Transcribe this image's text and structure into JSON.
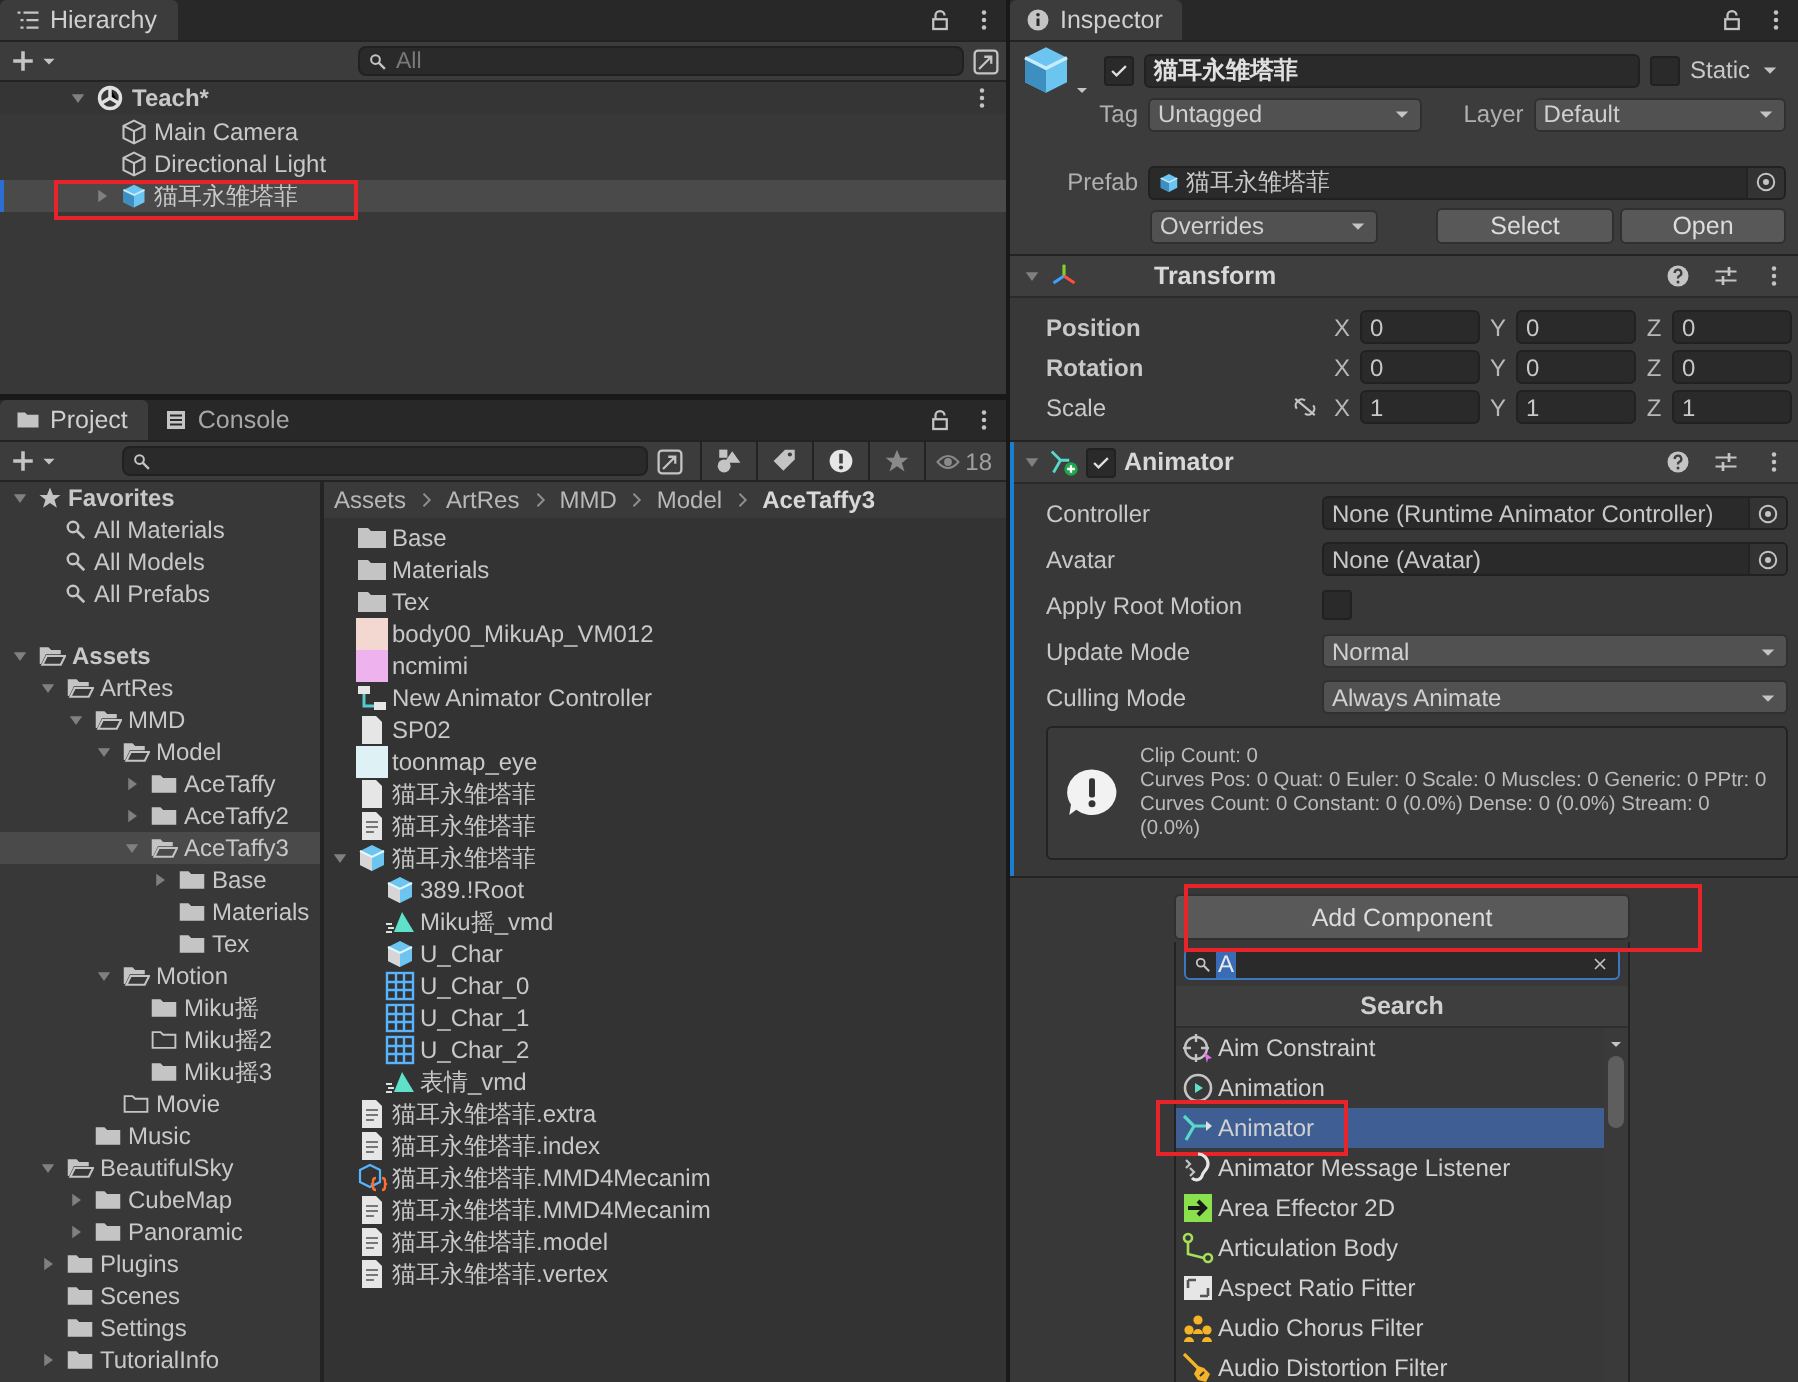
{
  "hierarchy": {
    "tab": "Hierarchy",
    "search": {
      "placeholder": "All"
    },
    "scene": {
      "name": "Teach*",
      "expanded": true
    },
    "items": [
      {
        "name": "Main Camera",
        "kind": "gameobject",
        "selected": false,
        "annotated": false
      },
      {
        "name": "Directional Light",
        "kind": "gameobject",
        "selected": false,
        "annotated": false
      },
      {
        "name": "猫耳永雏塔菲",
        "kind": "prefab",
        "expanded": false,
        "selected": true,
        "annotated": true
      }
    ]
  },
  "project": {
    "tabs": [
      {
        "label": "Project",
        "kind": "folder",
        "selected": true
      },
      {
        "label": "Console",
        "kind": "console",
        "selected": false
      }
    ],
    "hidden_count": "18",
    "favorites": {
      "label": "Favorites",
      "expanded": true,
      "items": [
        "All Materials",
        "All Models",
        "All Prefabs"
      ]
    },
    "tree": [
      {
        "name": "Assets",
        "expanded": true,
        "selected": false,
        "empty": false,
        "children": [
          {
            "name": "ArtRes",
            "expanded": true,
            "selected": false,
            "empty": false,
            "children": [
              {
                "name": "MMD",
                "expanded": true,
                "selected": false,
                "empty": false,
                "children": [
                  {
                    "name": "Model",
                    "expanded": true,
                    "selected": false,
                    "empty": false,
                    "children": [
                      {
                        "name": "AceTaffy",
                        "expanded": false,
                        "selected": false,
                        "empty": false
                      },
                      {
                        "name": "AceTaffy2",
                        "expanded": false,
                        "selected": false,
                        "empty": false
                      },
                      {
                        "name": "AceTaffy3",
                        "expanded": true,
                        "selected": true,
                        "empty": false,
                        "children": [
                          {
                            "name": "Base",
                            "expanded": false,
                            "selected": false,
                            "empty": false
                          },
                          {
                            "name": "Materials",
                            "selected": false,
                            "empty": false
                          },
                          {
                            "name": "Tex",
                            "selected": false,
                            "empty": false
                          }
                        ]
                      }
                    ]
                  },
                  {
                    "name": "Motion",
                    "expanded": true,
                    "selected": false,
                    "empty": false,
                    "children": [
                      {
                        "name": "Miku摇",
                        "selected": false,
                        "empty": false
                      },
                      {
                        "name": "Miku摇2",
                        "selected": false,
                        "empty": true
                      },
                      {
                        "name": "Miku摇3",
                        "selected": false,
                        "empty": false
                      }
                    ]
                  },
                  {
                    "name": "Movie",
                    "selected": false,
                    "empty": true
                  }
                ]
              },
              {
                "name": "Music",
                "selected": false,
                "empty": false
              }
            ]
          },
          {
            "name": "BeautifulSky",
            "expanded": true,
            "selected": false,
            "empty": false,
            "children": [
              {
                "name": "CubeMap",
                "expanded": false,
                "selected": false,
                "empty": false
              },
              {
                "name": "Panoramic",
                "expanded": false,
                "selected": false,
                "empty": false
              }
            ]
          },
          {
            "name": "Plugins",
            "expanded": false,
            "selected": false,
            "empty": false
          },
          {
            "name": "Scenes",
            "selected": false,
            "empty": false
          },
          {
            "name": "Settings",
            "selected": false,
            "empty": false
          },
          {
            "name": "TutorialInfo",
            "expanded": false,
            "selected": false,
            "empty": false
          }
        ]
      }
    ],
    "breadcrumb": [
      "Assets",
      "ArtRes",
      "MMD",
      "Model",
      "AceTaffy3"
    ],
    "files": [
      {
        "name": "Base",
        "kind": "folder"
      },
      {
        "name": "Materials",
        "kind": "folder"
      },
      {
        "name": "Tex",
        "kind": "folder"
      },
      {
        "name": "body00_MikuAp_VM012",
        "kind": "texture",
        "color": "#f2d8d0"
      },
      {
        "name": "ncmimi",
        "kind": "texture",
        "color": "#eeb2ee"
      },
      {
        "name": "New Animator Controller",
        "kind": "animator-controller"
      },
      {
        "name": "SP02",
        "kind": "blank-file"
      },
      {
        "name": "toonmap_eye",
        "kind": "texture",
        "color": "#def2f6"
      },
      {
        "name": "猫耳永雏塔菲",
        "kind": "blank-file"
      },
      {
        "name": "猫耳永雏塔菲",
        "kind": "text-file"
      },
      {
        "name": "猫耳永雏塔菲",
        "kind": "model",
        "expanded": true,
        "children": [
          {
            "name": "389.!Root",
            "kind": "model"
          },
          {
            "name": "Miku摇_vmd",
            "kind": "animation"
          },
          {
            "name": "U_Char",
            "kind": "model"
          },
          {
            "name": "U_Char_0",
            "kind": "mesh"
          },
          {
            "name": "U_Char_1",
            "kind": "mesh"
          },
          {
            "name": "U_Char_2",
            "kind": "mesh"
          },
          {
            "name": "表情_vmd",
            "kind": "animation"
          }
        ]
      },
      {
        "name": "猫耳永雏塔菲.extra",
        "kind": "text-file"
      },
      {
        "name": "猫耳永雏塔菲.index",
        "kind": "text-file"
      },
      {
        "name": "猫耳永雏塔菲.MMD4Mecanim",
        "kind": "mmd-asset"
      },
      {
        "name": "猫耳永雏塔菲.MMD4Mecanim",
        "kind": "text-file"
      },
      {
        "name": "猫耳永雏塔菲.model",
        "kind": "text-file"
      },
      {
        "name": "猫耳永雏塔菲.vertex",
        "kind": "text-file"
      }
    ]
  },
  "inspector": {
    "tab": "Inspector",
    "object": {
      "active": true,
      "name": "猫耳永雏塔菲",
      "static": false,
      "static_label": "Static",
      "tag_label": "Tag",
      "tag": "Untagged",
      "layer_label": "Layer",
      "layer": "Default",
      "prefab_label": "Prefab",
      "prefab": "猫耳永雏塔菲",
      "overrides": "Overrides",
      "buttons": [
        "Select",
        "Open"
      ]
    },
    "components": [
      {
        "kind": "transform",
        "title": "Transform",
        "expanded": true,
        "added": false,
        "rows": [
          {
            "label": "Position",
            "overridden": true,
            "fields": [
              {
                "axis": "X",
                "value": "0"
              },
              {
                "axis": "Y",
                "value": "0"
              },
              {
                "axis": "Z",
                "value": "0"
              }
            ]
          },
          {
            "label": "Rotation",
            "overridden": true,
            "fields": [
              {
                "axis": "X",
                "value": "0"
              },
              {
                "axis": "Y",
                "value": "0"
              },
              {
                "axis": "Z",
                "value": "0"
              }
            ]
          },
          {
            "label": "Scale",
            "overridden": false,
            "constrain_proportions": false,
            "fields": [
              {
                "axis": "X",
                "value": "1"
              },
              {
                "axis": "Y",
                "value": "1"
              },
              {
                "axis": "Z",
                "value": "1"
              }
            ]
          }
        ]
      },
      {
        "kind": "animator",
        "title": "Animator",
        "expanded": true,
        "added": true,
        "enabled": true,
        "fields": [
          {
            "kind": "object",
            "label": "Controller",
            "value": "None (Runtime Animator Controller)"
          },
          {
            "kind": "object",
            "label": "Avatar",
            "value": "None (Avatar)"
          },
          {
            "kind": "checkbox",
            "label": "Apply Root Motion",
            "checked": false
          },
          {
            "kind": "dropdown",
            "label": "Update Mode",
            "value": "Normal"
          },
          {
            "kind": "dropdown",
            "label": "Culling Mode",
            "value": "Always Animate"
          }
        ],
        "info": [
          "Clip Count: 0",
          "Curves Pos: 0 Quat: 0 Euler: 0 Scale: 0 Muscles: 0 Generic: 0 PPtr: 0",
          "Curves Count: 0 Constant: 0 (0.0%) Dense: 0 (0.0%) Stream: 0 (0.0%)"
        ]
      }
    ],
    "add_component": {
      "label": "Add Component",
      "annotated": true
    },
    "component_search": {
      "query": "A",
      "header": "Search",
      "items": [
        {
          "name": "Aim Constraint",
          "kind": "aim",
          "selected": false,
          "annotated": false
        },
        {
          "name": "Animation",
          "kind": "play-circle",
          "selected": false,
          "annotated": false
        },
        {
          "name": "Animator",
          "kind": "animator",
          "selected": true,
          "annotated": true
        },
        {
          "name": "Animator Message Listener",
          "kind": "listener",
          "selected": false,
          "annotated": false
        },
        {
          "name": "Area Effector 2D",
          "kind": "effector",
          "selected": false,
          "annotated": false
        },
        {
          "name": "Articulation Body",
          "kind": "joints",
          "selected": false,
          "annotated": false
        },
        {
          "name": "Aspect Ratio Fitter",
          "kind": "aspect",
          "selected": false,
          "annotated": false
        },
        {
          "name": "Audio Chorus Filter",
          "kind": "chorus",
          "selected": false,
          "annotated": false
        },
        {
          "name": "Audio Distortion Filter",
          "kind": "distortion",
          "selected": false,
          "annotated": false
        }
      ]
    }
  }
}
